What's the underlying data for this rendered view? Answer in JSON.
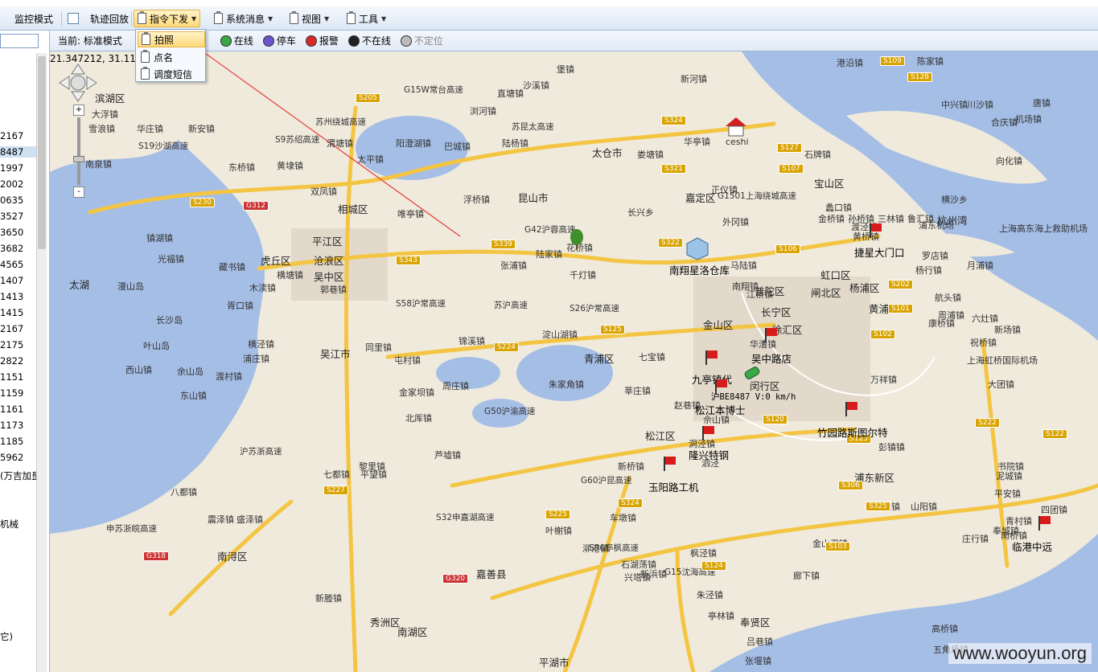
{
  "toolbar": {
    "monitor_mode": "监控模式",
    "track_playback": "轨迹回放",
    "command_send": "指令下发",
    "system_messages": "系统消息",
    "view": "视图",
    "tools": "工具"
  },
  "dropdown": {
    "items": [
      "拍照",
      "点名",
      "调度短信"
    ]
  },
  "statusbar": {
    "mode": "当前: 标准模式",
    "legend": [
      "在线",
      "停车",
      "报警",
      "不在线",
      "不定位"
    ]
  },
  "coords": "21.347212, 31.117",
  "left_list": [
    "2167",
    "8487",
    "1997",
    "2002",
    "0635",
    "3527",
    "3650",
    "3682",
    "4565",
    "1407",
    "1413",
    "1415",
    "2167",
    "2175",
    "2822",
    "1151",
    "1159",
    "1161",
    "1173",
    "1185",
    "5962",
    "(万吉加昰",
    "机械",
    "它)"
  ],
  "map": {
    "places": [
      {
        "t": "滨湖区",
        "c": "big"
      },
      {
        "t": "大浮镇"
      },
      {
        "t": "雪浪镇"
      },
      {
        "t": "华庄镇"
      },
      {
        "t": "新安镇"
      },
      {
        "t": "南泉镇"
      },
      {
        "t": "东桥镇"
      },
      {
        "t": "黄埭镇"
      },
      {
        "t": "渭塘镇"
      },
      {
        "t": "太平镇"
      },
      {
        "t": "阳澄湖镇"
      },
      {
        "t": "巴城镇"
      },
      {
        "t": "陆杨镇"
      },
      {
        "t": "太仓市",
        "c": "big"
      },
      {
        "t": "娄塘镇"
      },
      {
        "t": "华亭镇"
      },
      {
        "t": "嘉定区",
        "c": "big"
      },
      {
        "t": "宝山区",
        "c": "big"
      },
      {
        "t": "相城区",
        "c": "big"
      },
      {
        "t": "昆山市",
        "c": "big"
      },
      {
        "t": "唯亭镇"
      },
      {
        "t": "平江区",
        "c": "big"
      },
      {
        "t": "沧浪区",
        "c": "big"
      },
      {
        "t": "虎丘区",
        "c": "big"
      },
      {
        "t": "吴中区",
        "c": "big"
      },
      {
        "t": "太湖",
        "c": "big"
      },
      {
        "t": "漫山岛"
      },
      {
        "t": "光福镇"
      },
      {
        "t": "镇湖镇"
      },
      {
        "t": "藏书镇"
      },
      {
        "t": "木渎镇"
      },
      {
        "t": "横塘镇"
      },
      {
        "t": "郭巷镇"
      },
      {
        "t": "胥口镇"
      },
      {
        "t": "长沙岛"
      },
      {
        "t": "叶山岛"
      },
      {
        "t": "西山镇"
      },
      {
        "t": "余山岛"
      },
      {
        "t": "东山镇"
      },
      {
        "t": "渡村镇"
      },
      {
        "t": "浦庄镇"
      },
      {
        "t": "横泾镇"
      },
      {
        "t": "吴江市",
        "c": "big"
      },
      {
        "t": "同里镇"
      },
      {
        "t": "屯村镇"
      },
      {
        "t": "金家坝镇"
      },
      {
        "t": "周庄镇"
      },
      {
        "t": "北厍镇"
      },
      {
        "t": "芦墟镇"
      },
      {
        "t": "黎里镇"
      },
      {
        "t": "平望镇"
      },
      {
        "t": "七都镇"
      },
      {
        "t": "八都镇"
      },
      {
        "t": "震泽镇"
      },
      {
        "t": "盛泽镇"
      },
      {
        "t": "南浔区",
        "c": "big"
      },
      {
        "t": "新塍镇"
      },
      {
        "t": "秀洲区",
        "c": "big"
      },
      {
        "t": "南湖区",
        "c": "big"
      },
      {
        "t": "嘉善县",
        "c": "big"
      },
      {
        "t": "平湖市",
        "c": "big"
      },
      {
        "t": "青浦区",
        "c": "big"
      },
      {
        "t": "朱家角镇"
      },
      {
        "t": "千灯镇"
      },
      {
        "t": "陆家镇"
      },
      {
        "t": "花桥镇"
      },
      {
        "t": "张浦镇"
      },
      {
        "t": "淀山湖镇"
      },
      {
        "t": "锦溪镇"
      },
      {
        "t": "松江区",
        "c": "big"
      },
      {
        "t": "闵行区",
        "c": "big"
      },
      {
        "t": "徐汇区",
        "c": "big"
      },
      {
        "t": "长宁区",
        "c": "big"
      },
      {
        "t": "普陀区",
        "c": "big"
      },
      {
        "t": "闸北区",
        "c": "big"
      },
      {
        "t": "虹口区",
        "c": "big"
      },
      {
        "t": "杨浦区",
        "c": "big"
      },
      {
        "t": "黄浦区",
        "c": "big"
      },
      {
        "t": "浦东新区",
        "c": "big"
      },
      {
        "t": "奉贤区",
        "c": "big"
      },
      {
        "t": "金山区",
        "c": "big"
      },
      {
        "t": "上海虹桥国际机场"
      },
      {
        "t": "浦东机场"
      },
      {
        "t": "上海高东海上救助机场"
      },
      {
        "t": "横沙乡"
      },
      {
        "t": "长兴乡"
      },
      {
        "t": "外冈镇"
      },
      {
        "t": "马陆镇"
      },
      {
        "t": "南翔镇"
      },
      {
        "t": "江桥镇"
      },
      {
        "t": "华漕镇"
      },
      {
        "t": "七宝镇"
      },
      {
        "t": "莘庄镇"
      },
      {
        "t": "赵巷镇"
      },
      {
        "t": "佘山镇"
      },
      {
        "t": "洞泾镇"
      },
      {
        "t": "泗泾"
      },
      {
        "t": "新桥镇"
      },
      {
        "t": "车墩镇"
      },
      {
        "t": "叶榭镇"
      },
      {
        "t": "泖港镇"
      },
      {
        "t": "石湖荡镇"
      },
      {
        "t": "新浜镇"
      },
      {
        "t": "枫泾镇"
      },
      {
        "t": "兴塔镇"
      },
      {
        "t": "朱泾镇"
      },
      {
        "t": "亭林镇"
      },
      {
        "t": "吕巷镇"
      },
      {
        "t": "张堰镇"
      },
      {
        "t": "廊下镇"
      },
      {
        "t": "金山卫镇"
      },
      {
        "t": "漕泾镇"
      },
      {
        "t": "山阳镇"
      },
      {
        "t": "庄行镇"
      },
      {
        "t": "南桥镇"
      },
      {
        "t": "青村镇"
      },
      {
        "t": "奉城镇"
      },
      {
        "t": "四团镇"
      },
      {
        "t": "平安镇"
      },
      {
        "t": "泥城镇"
      },
      {
        "t": "书院镇"
      },
      {
        "t": "彭镇镇"
      },
      {
        "t": "万祥镇"
      },
      {
        "t": "大团镇"
      },
      {
        "t": "新场镇"
      },
      {
        "t": "航头镇"
      },
      {
        "t": "周浦镇"
      },
      {
        "t": "康桥镇"
      },
      {
        "t": "六灶镇"
      },
      {
        "t": "祝桥镇"
      },
      {
        "t": "川沙镇"
      },
      {
        "t": "唐镇"
      },
      {
        "t": "合庆镇"
      },
      {
        "t": "机场镇"
      },
      {
        "t": "向化镇"
      },
      {
        "t": "中兴镇"
      },
      {
        "t": "陈家镇"
      },
      {
        "t": "港沿镇"
      },
      {
        "t": "堡镇"
      },
      {
        "t": "新河镇"
      },
      {
        "t": "沙溪镇"
      },
      {
        "t": "浏河镇"
      },
      {
        "t": "浮桥镇"
      },
      {
        "t": "直塘镇"
      },
      {
        "t": "双凤镇"
      },
      {
        "t": "石牌镇"
      },
      {
        "t": "正仪镇"
      },
      {
        "t": "蠡口镇"
      },
      {
        "t": "黄桥镇"
      },
      {
        "t": "渡泾镇"
      },
      {
        "t": "罗店镇"
      },
      {
        "t": "月浦镇"
      },
      {
        "t": "杨行镇"
      },
      {
        "t": "高桥镇"
      },
      {
        "t": "五角场镇"
      },
      {
        "t": "金桥镇"
      },
      {
        "t": "孙桥镇"
      },
      {
        "t": "三林镇"
      },
      {
        "t": "鲁汇镇"
      },
      {
        "t": "杭州湾",
        "c": "big"
      }
    ],
    "pois": [
      "ceshi",
      "南翔星洛仓库",
      "捷星大门口",
      "吴中路店",
      "九亭镇代",
      "沪BE8487 V:0 km/h",
      "松江本博士",
      "竹园路斯图尔特",
      "隆兴特钢",
      "玉阳路工机",
      "临港中远"
    ],
    "roads": [
      "G15W常台高速",
      "苏州绕城高速",
      "S9苏绍高速",
      "G1501上海绕城高速",
      "G42沪蓉高速",
      "S58沪常高速",
      "苏沪高速",
      "S26沪常高速",
      "G50沪渝高速",
      "S32申嘉湖高速",
      "S36亭枫高速",
      "G15沈海高速",
      "沪苏浙高速",
      "申苏浙皖高速",
      "G60沪昆高速",
      "苏昆太高速",
      "S19沙湖高速"
    ],
    "shields": [
      "S205",
      "S230",
      "G312",
      "S343",
      "S339",
      "S322",
      "S321",
      "S324",
      "S127",
      "S107",
      "S106",
      "S125",
      "S224",
      "S120",
      "S102",
      "S101",
      "S202",
      "S222",
      "S123",
      "S227",
      "G318",
      "S225",
      "S324",
      "S124",
      "S103",
      "S306",
      "S325",
      "S122",
      "S109",
      "S128",
      "G320"
    ],
    "watermark": "www.wooyun.org"
  }
}
